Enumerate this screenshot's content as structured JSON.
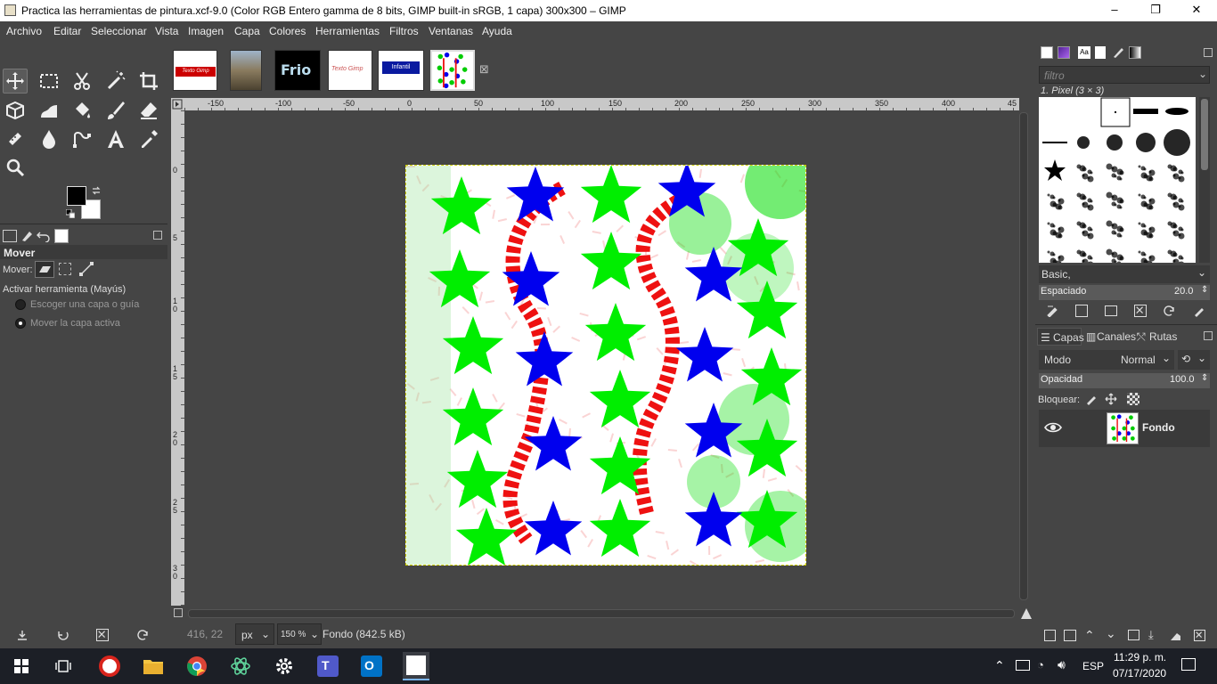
{
  "window": {
    "title": "Practica las herramientas de pintura.xcf-9.0 (Color RGB Entero gamma de 8 bits, GIMP built-in sRGB, 1 capa) 300x300 – GIMP",
    "minimize": "–",
    "maximize": "❐",
    "close": "✕"
  },
  "menu": [
    "Archivo",
    "Editar",
    "Seleccionar",
    "Vista",
    "Imagen",
    "Capa",
    "Colores",
    "Herramientas",
    "Filtros",
    "Ventanas",
    "Ayuda"
  ],
  "image_tabs": {
    "thumb1_text": "Texto Gimp",
    "thumb3_text": "Frio",
    "thumb4_text": "Texto Gimp",
    "thumb5_text": "Infantil",
    "close_icon": "⊠"
  },
  "tool_options": {
    "title": "Mover",
    "move_label": "Mover:",
    "toggle_label": "Activar herramienta  (Mayús)",
    "option1": "Escoger una capa o guía",
    "option2": "Mover la capa activa"
  },
  "rulers": {
    "top": [
      "-150",
      "-100",
      "-50",
      "0",
      "50",
      "100",
      "150",
      "200",
      "250",
      "300",
      "350",
      "400",
      "45"
    ],
    "left": [
      "0",
      "5",
      "1\n0",
      "1\n5",
      "2\n0",
      "2\n5",
      "3\n0"
    ]
  },
  "status": {
    "coords": "416, 22",
    "unit": "px",
    "zoom": "150 %",
    "layer_info": "Fondo (842.5 kB)"
  },
  "brushes": {
    "filter_placeholder": "filtro",
    "selected": "1. Pixel (3 × 3)",
    "preset": "Basic,",
    "spacing_label": "Espaciado",
    "spacing_value": "20.0"
  },
  "layers": {
    "tabs": [
      "Capas",
      "Canales",
      "Rutas"
    ],
    "mode_label": "Modo",
    "mode_value": "Normal",
    "opacity_label": "Opacidad",
    "opacity_value": "100.0",
    "lock_label": "Bloquear:",
    "layer_name": "Fondo"
  },
  "taskbar": {
    "lang": "ESP",
    "time": "11:29 p. m.",
    "date": "07/17/2020"
  },
  "colors": {
    "panel": "#454545",
    "star_green": "#00ee00",
    "star_blue": "#0000ee",
    "paint_red": "#ee1111"
  }
}
